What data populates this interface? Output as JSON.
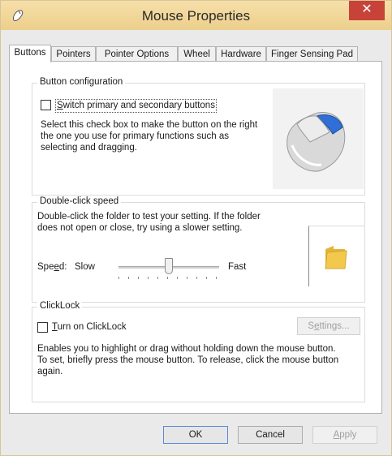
{
  "window": {
    "title": "Mouse Properties",
    "close_glyph": "✕"
  },
  "tabs": [
    {
      "label": "Buttons"
    },
    {
      "label": "Pointers"
    },
    {
      "label": "Pointer Options"
    },
    {
      "label": "Wheel"
    },
    {
      "label": "Hardware"
    },
    {
      "label": "Finger Sensing Pad"
    }
  ],
  "button_config": {
    "legend": "Button configuration",
    "switch_checkbox": {
      "pre": "",
      "key": "S",
      "post": "witch primary and secondary buttons",
      "checked": false
    },
    "description_lines": [
      "Select this check box to make the button on the right",
      "the one you use for primary functions such as",
      "selecting and dragging."
    ]
  },
  "double_click": {
    "legend": "Double-click speed",
    "description_lines": [
      "Double-click the folder to test your setting. If the folder",
      "does not open or close, try using a slower setting."
    ],
    "speed_label": {
      "pre": "Spe",
      "key": "e",
      "post": "d:"
    },
    "slow_label": "Slow",
    "fast_label": "Fast",
    "slider_value": 0.5
  },
  "clicklock": {
    "legend": "ClickLock",
    "checkbox": {
      "pre": "",
      "key": "T",
      "post": "urn on ClickLock",
      "checked": false
    },
    "settings_button": {
      "pre": "S",
      "key": "e",
      "post": "ttings..."
    },
    "description_lines": [
      "Enables you to highlight or drag without holding down the mouse button.",
      "To set, briefly press the mouse button. To release, click the mouse button",
      "again."
    ]
  },
  "footer": {
    "ok": "OK",
    "cancel": "Cancel",
    "apply": {
      "pre": "",
      "key": "A",
      "post": "pply"
    }
  },
  "colors": {
    "titlebar": "#eccf8c",
    "close": "#c7433a",
    "folder": "#f2c94c"
  }
}
